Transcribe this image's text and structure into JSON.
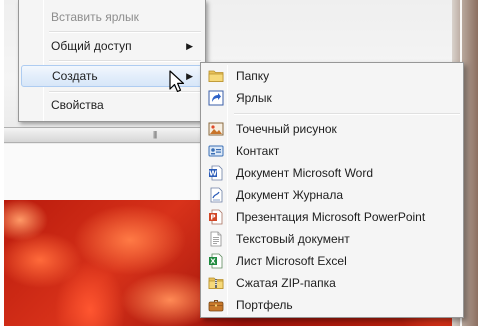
{
  "parent_menu": {
    "items": [
      {
        "label": "Вставить ярлык",
        "disabled": true,
        "has_submenu": false
      },
      {
        "label": "Общий доступ",
        "disabled": false,
        "has_submenu": true
      },
      {
        "label": "Создать",
        "disabled": false,
        "has_submenu": true,
        "selected": true
      },
      {
        "label": "Свойства",
        "disabled": false,
        "has_submenu": false
      }
    ],
    "submenu_arrow": "▶"
  },
  "new_submenu": {
    "items": [
      {
        "label": "Папку",
        "icon": "folder-icon"
      },
      {
        "label": "Ярлык",
        "icon": "shortcut-icon"
      },
      {
        "label": "Точечный рисунок",
        "icon": "bitmap-image-icon"
      },
      {
        "label": "Контакт",
        "icon": "contact-card-icon"
      },
      {
        "label": "Документ Microsoft Word",
        "icon": "word-document-icon"
      },
      {
        "label": "Документ Журнала",
        "icon": "journal-document-icon"
      },
      {
        "label": "Презентация Microsoft PowerPoint",
        "icon": "powerpoint-presentation-icon"
      },
      {
        "label": "Текстовый документ",
        "icon": "text-document-icon"
      },
      {
        "label": "Лист Microsoft Excel",
        "icon": "excel-sheet-icon"
      },
      {
        "label": "Сжатая ZIP-папка",
        "icon": "zip-folder-icon"
      },
      {
        "label": "Портфель",
        "icon": "briefcase-icon"
      }
    ]
  },
  "scrollbar": {
    "grip": "|||"
  },
  "colors": {
    "menu_bg": "#f5f5f5",
    "menu_border": "#979797",
    "selected_bg": "#e3eefb",
    "selected_border": "#aeccf1",
    "disabled_text": "#8d8d8d",
    "wallpaper": "#c2260f"
  }
}
